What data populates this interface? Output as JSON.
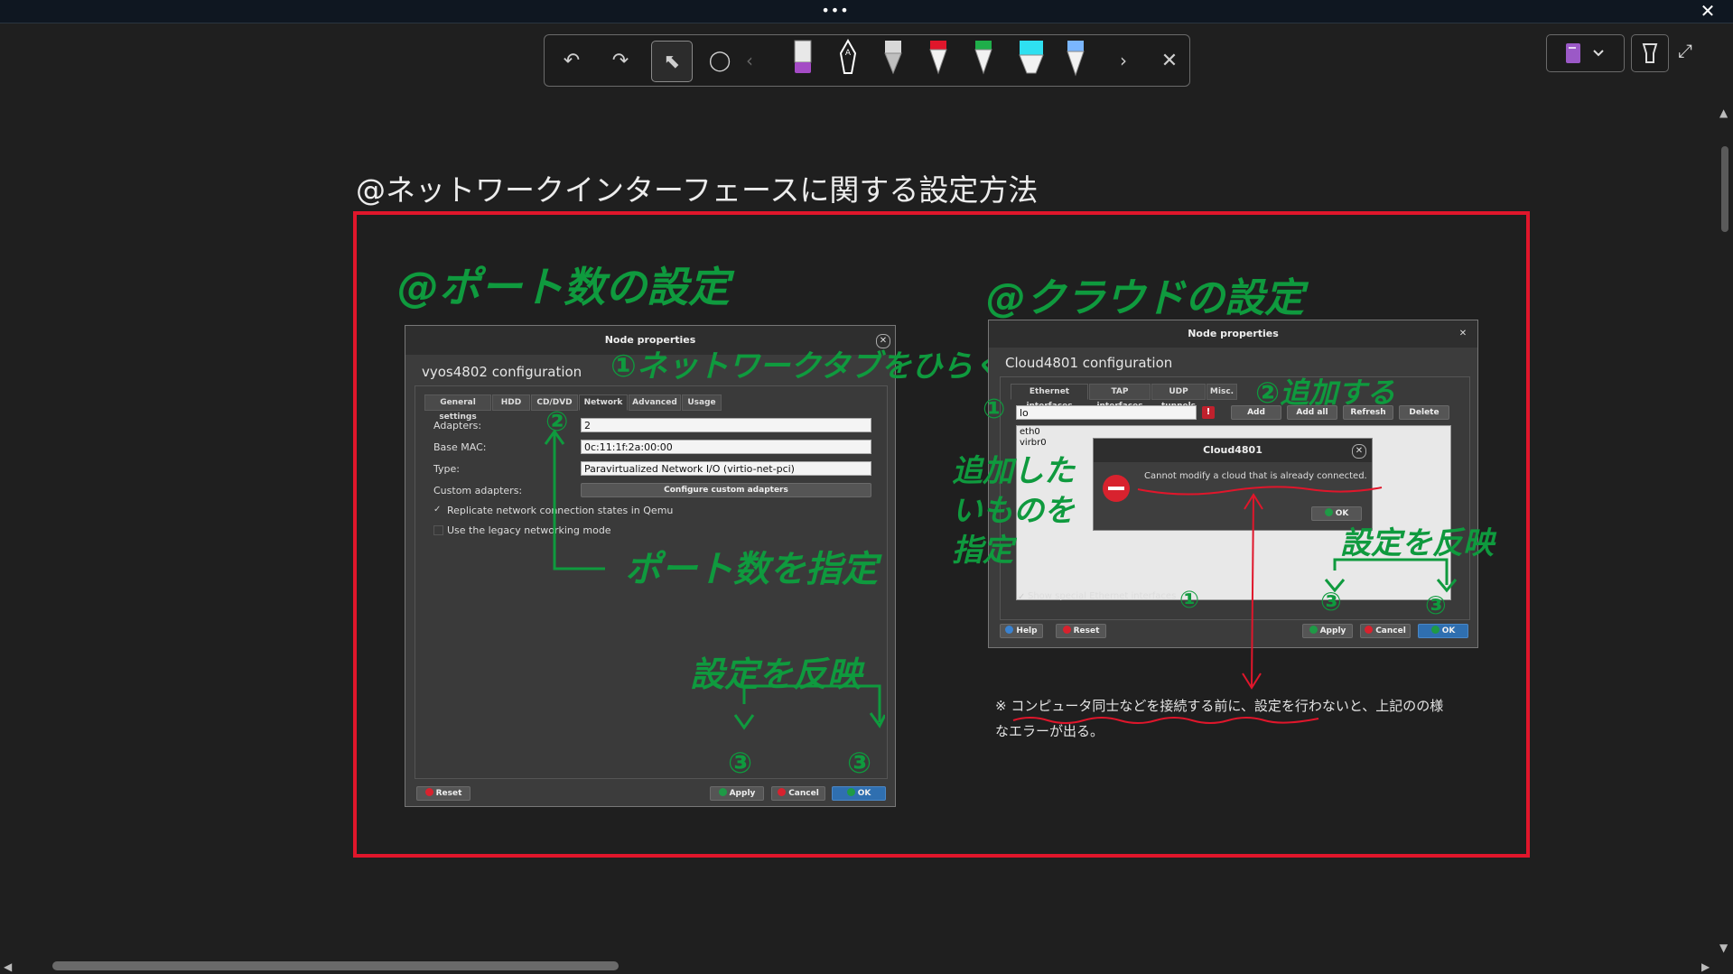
{
  "window": {
    "menu_dots": "•••",
    "close": "✕"
  },
  "toolbar": {
    "undo": "↶",
    "redo": "↷",
    "select": "⬉",
    "lasso": "◯",
    "prev": "‹",
    "next": "›",
    "close": "✕",
    "pens": [
      {
        "name": "highlighter-purple",
        "color": "#a44bc5"
      },
      {
        "name": "pen-ink",
        "color": "#ffffff"
      },
      {
        "name": "pen-gray",
        "color": "#d8d8d8"
      },
      {
        "name": "pen-red",
        "color": "#e0162b"
      },
      {
        "name": "pen-green",
        "color": "#1fae4a"
      },
      {
        "name": "highlighter-cyan",
        "color": "#2fe0f0"
      },
      {
        "name": "pen-blue",
        "color": "#7ab6ff"
      }
    ]
  },
  "page": {
    "title": "@ネットワークインターフェースに関する設定方法",
    "left_heading": "@ポート数の設定",
    "right_heading": "@クラウドの設定"
  },
  "left_dialog": {
    "title": "Node properties",
    "config_title": "vyos4802 configuration",
    "tabs": [
      "General settings",
      "HDD",
      "CD/DVD",
      "Network",
      "Advanced",
      "Usage"
    ],
    "active_tab": "Network",
    "adapters_label": "Adapters:",
    "adapters_value": "2",
    "base_mac_label": "Base MAC:",
    "base_mac_value": "0c:11:1f:2a:00:00",
    "type_label": "Type:",
    "type_value": "Paravirtualized Network I/O (virtio-net-pci)",
    "custom_label": "Custom adapters:",
    "custom_button": "Configure custom adapters",
    "replicate_label": "Replicate network connection states in Qemu",
    "legacy_label": "Use the legacy networking mode",
    "reset": "Reset",
    "apply": "Apply",
    "cancel": "Cancel",
    "ok": "OK"
  },
  "left_annotations": {
    "step1": "①ネットワークタブをひらく",
    "step2": "②",
    "specify_ports": "ポート数を指定",
    "reflect": "設定を反映",
    "step3a": "③",
    "step3b": "③"
  },
  "right_dialog": {
    "title": "Node properties",
    "config_title": "Cloud4801 configuration",
    "tabs": [
      "Ethernet interfaces",
      "TAP interfaces",
      "UDP tunnels",
      "Misc."
    ],
    "active_tab": "Ethernet interfaces",
    "combo_value": "lo",
    "add": "Add",
    "add_all": "Add all",
    "refresh": "Refresh",
    "delete": "Delete",
    "interfaces": [
      "eth0",
      "virbr0"
    ],
    "show_special": "Show special Ethernet interfaces",
    "help": "Help",
    "reset": "Reset",
    "apply": "Apply",
    "cancel": "Cancel",
    "ok": "OK"
  },
  "error_dialog": {
    "title": "Cloud4801",
    "message": "Cannot modify a cloud that is already connected.",
    "ok": "OK"
  },
  "right_annotations": {
    "step1": "①",
    "step2": "②追加する",
    "specify": "追加したいものを指定",
    "reflect": "設定を反映",
    "step3a": "③",
    "step3b": "③",
    "step_alt": "①"
  },
  "note": {
    "text1": "※ コンピュータ同士などを接続する前に、設定を行わないと、上記のの様",
    "text2": "なエラーが出る。"
  }
}
